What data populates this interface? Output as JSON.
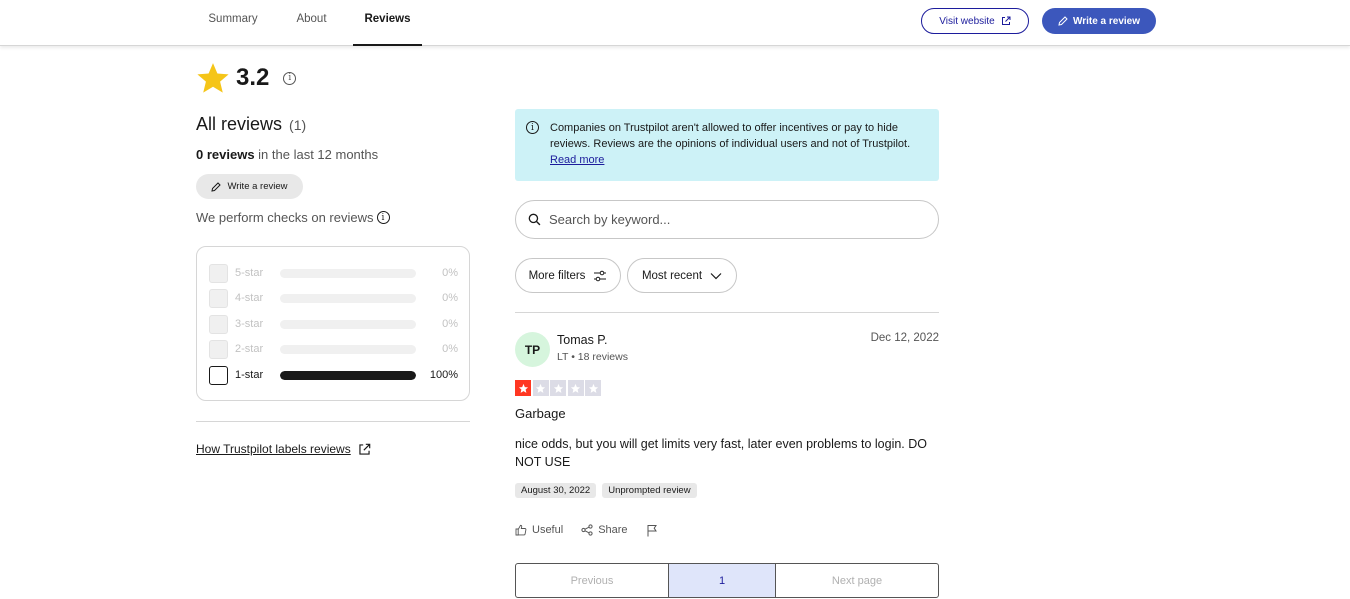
{
  "nav": {
    "tabs": [
      {
        "label": "Summary"
      },
      {
        "label": "About"
      },
      {
        "label": "Reviews"
      }
    ],
    "visit_label": "Visit website",
    "write_label": "Write a review"
  },
  "summary": {
    "rating": "3.2",
    "all_reviews_label": "All reviews",
    "all_reviews_count": "(1)",
    "period_count": "0 reviews",
    "period_rest": "in the last 12 months",
    "write_label": "Write a review",
    "checks_label": "We perform checks on reviews",
    "distribution": [
      {
        "label": "5-star",
        "pct": "0%",
        "value": 0
      },
      {
        "label": "4-star",
        "pct": "0%",
        "value": 0
      },
      {
        "label": "3-star",
        "pct": "0%",
        "value": 0
      },
      {
        "label": "2-star",
        "pct": "0%",
        "value": 0
      },
      {
        "label": "1-star",
        "pct": "100%",
        "value": 100
      }
    ],
    "how_link": "How Trustpilot labels reviews"
  },
  "notice": {
    "text": "Companies on Trustpilot aren't allowed to offer incentives or pay to hide reviews. Reviews are the opinions of individual users and not of Trustpilot.",
    "link": "Read more"
  },
  "search": {
    "placeholder": "Search by keyword..."
  },
  "filters": {
    "more_label": "More filters",
    "sort_label": "Most recent"
  },
  "review": {
    "initials": "TP",
    "name": "Tomas P.",
    "meta": "LT • 18 reviews",
    "date": "Dec 12, 2022",
    "stars": 1,
    "title": "Garbage",
    "body": "nice odds, but you will get limits very fast, later even problems to login. DO NOT USE",
    "tags": [
      "August 30, 2022",
      "Unprompted review"
    ],
    "useful_label": "Useful",
    "share_label": "Share"
  },
  "pagination": {
    "prev": "Previous",
    "current": "1",
    "next": "Next page"
  },
  "colors": {
    "brand": "#3c57bc",
    "star_red": "#ff3722",
    "notice_bg": "#cdf2f7",
    "rating_star": "#f5c518"
  }
}
